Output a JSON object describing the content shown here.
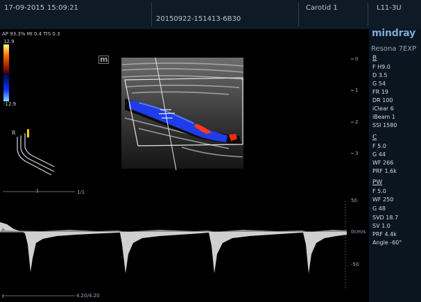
{
  "header": {
    "date": "17-09-2015",
    "time": "15:09:21",
    "study_id": "20150922-151413-6B30",
    "preset": "Carotid 1",
    "probe": "L11-3U"
  },
  "safety_line": "AP 93.3%  MI 0.4  TIS 0.3",
  "colorbar": {
    "max": "12.9",
    "min": "-12.9"
  },
  "marker_m": "m",
  "probe_mark_r": "R",
  "brand": {
    "name": "mindray",
    "model": "Resona 7EXP"
  },
  "b_mode": {
    "title": "B",
    "params": [
      "F H9.0",
      "D 3.5",
      "G 54",
      "FR 19",
      "DR 100",
      "iClear 6",
      "iBeam 1",
      "SSI 1580"
    ]
  },
  "c_mode": {
    "title": "C",
    "params": [
      "F 5.0",
      "G 44",
      "WF 266",
      "PRF 1.6k"
    ]
  },
  "pw_mode": {
    "title": "PW",
    "params": [
      "F 5.0",
      "WF 250",
      "G 48",
      "SVD 18.7",
      "SV 1.0",
      "PRF 4.4k",
      "Angle  -60°"
    ]
  },
  "depth_scale": [
    "0",
    "1",
    "2",
    "3"
  ],
  "velocity_scale": {
    "top": "50",
    "zero": "0cm/s",
    "bottom": "-50"
  },
  "timeline_upper": "1/1",
  "timeline_lower": "4.20/4.20"
}
